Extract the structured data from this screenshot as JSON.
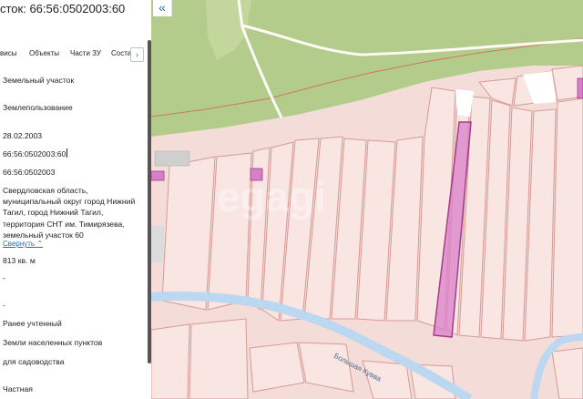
{
  "panel": {
    "title": "сток: 66:56:0502003:60",
    "tabs": [
      "висы",
      "Объекты",
      "Части ЗУ",
      "Соста"
    ],
    "more_label": "›",
    "fields": {
      "type": "Земельный участок",
      "subtype": "Землепользование",
      "date": "28.02.2003",
      "cad_number": "66:56:0502003:60",
      "quarter": "66:56:0502003",
      "address": "Свердловская область, муниципальный округ город Нижний Тагил, город Нижний Тагил, территория СНТ им. Тимирязева, земельный участок 60",
      "collapse_link": "Свернуть",
      "area": "813 кв. м",
      "dash1": "-",
      "dash2": "-",
      "status": "Ранее учтенный",
      "category": "Земли населенных пунктов",
      "use": "для садоводства",
      "ownership": "Частная"
    }
  },
  "map": {
    "collapse_icon": "«",
    "river_label": "Большая Кувва",
    "watermark": "egagi"
  },
  "colors": {
    "forest": "#b3cc8c",
    "parcel_fill": "#f6e4e2",
    "parcel_line": "#d79a94",
    "selected_fill": "#d97fc8",
    "selected_line": "#a33d8c",
    "river": "#bcd7f0",
    "link": "#2b6cb0"
  }
}
